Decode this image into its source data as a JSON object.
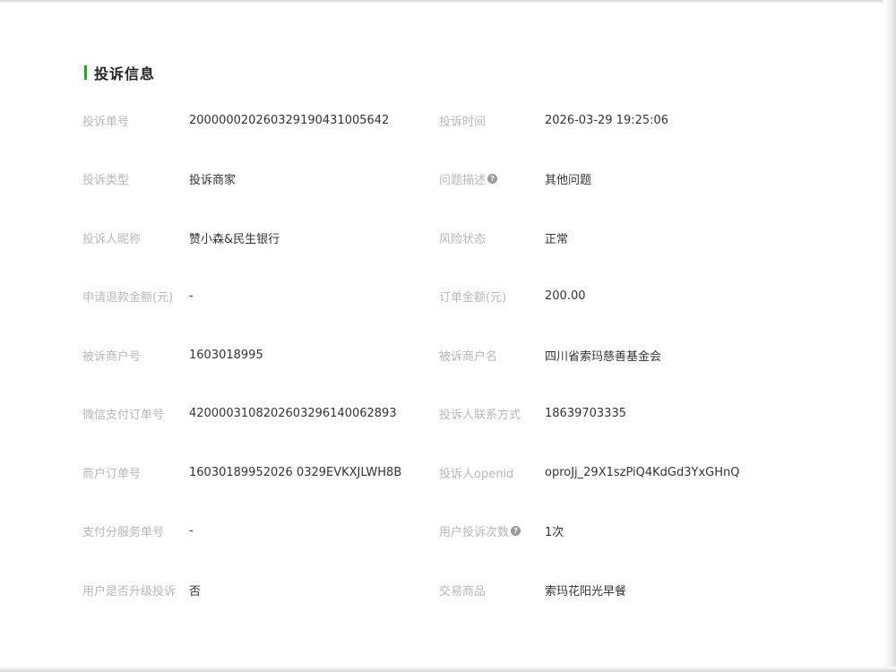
{
  "section": {
    "title": "投诉信息"
  },
  "rows": [
    {
      "left": {
        "label": "投诉单号",
        "value": "200000020260329190431005642"
      },
      "right": {
        "label": "投诉时间",
        "value": "2026-03-29 19:25:06"
      }
    },
    {
      "left": {
        "label": "投诉类型",
        "value": "投诉商家"
      },
      "right": {
        "label": "问题描述",
        "value": "其他问题",
        "help_icon": "question-circle-icon"
      }
    },
    {
      "left": {
        "label": "投诉人昵称",
        "value": "赞小森&民生银行"
      },
      "right": {
        "label": "风险状态",
        "value": "正常"
      }
    },
    {
      "left": {
        "label": "申请退款金额(元)",
        "value": "-"
      },
      "right": {
        "label": "订单金额(元)",
        "value": "200.00"
      }
    },
    {
      "left": {
        "label": "被诉商户号",
        "value": "1603018995"
      },
      "right": {
        "label": "被诉商户名",
        "value": "四川省索玛慈善基金会"
      }
    },
    {
      "left": {
        "label": "微信支付订单号",
        "value": "4200003108202603296140062893"
      },
      "right": {
        "label": "投诉人联系方式",
        "value": "18639703335"
      }
    },
    {
      "left": {
        "label": "商户订单号",
        "value": "16030189952026 0329EVKXJLWH8B"
      },
      "right": {
        "label": "投诉人openid",
        "value": "oproJj_29X1szPiQ4KdGd3YxGHnQ"
      }
    },
    {
      "left": {
        "label": "支付分服务单号",
        "value": "-"
      },
      "right": {
        "label": "用户投诉次数",
        "value": "1次",
        "help_icon": "question-circle-icon"
      }
    },
    {
      "left": {
        "label": "用户是否升级投诉",
        "value": "否"
      },
      "right": {
        "label": "交易商品",
        "value": "索玛花阳光早餐"
      }
    }
  ],
  "colors": {
    "accent": "#1aad19",
    "label": "#b8b8b8",
    "value": "#333333",
    "title": "#222222"
  }
}
